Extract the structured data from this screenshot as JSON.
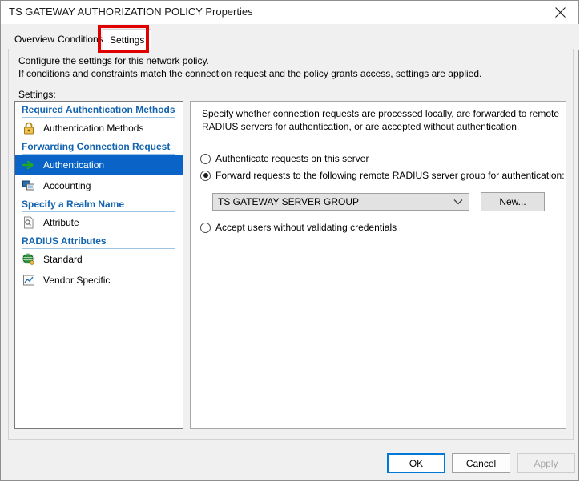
{
  "window": {
    "title": "TS GATEWAY AUTHORIZATION POLICY Properties",
    "close_icon": "close-icon"
  },
  "tabs": [
    {
      "label": "Overview",
      "selected": false
    },
    {
      "label": "Conditions",
      "selected": false
    },
    {
      "label": "Settings",
      "selected": true
    }
  ],
  "page": {
    "description_line1": "Configure the settings for this network policy.",
    "description_line2": "If conditions and constraints match the connection request and the policy grants access, settings are applied.",
    "settings_label": "Settings:"
  },
  "nav": {
    "groups": [
      {
        "header": "Required Authentication Methods",
        "items": [
          {
            "label": "Authentication Methods",
            "icon": "padlock-icon",
            "selected": false
          }
        ]
      },
      {
        "header": "Forwarding Connection Request",
        "items": [
          {
            "label": "Authentication",
            "icon": "green-arrow-icon",
            "selected": true
          },
          {
            "label": "Accounting",
            "icon": "monitor-icon",
            "selected": false
          }
        ]
      },
      {
        "header": "Specify a Realm Name",
        "items": [
          {
            "label": "Attribute",
            "icon": "document-search-icon",
            "selected": false
          }
        ]
      },
      {
        "header": "RADIUS Attributes",
        "items": [
          {
            "label": "Standard",
            "icon": "globe-key-icon",
            "selected": false
          },
          {
            "label": "Vendor Specific",
            "icon": "chart-icon",
            "selected": false
          }
        ]
      }
    ]
  },
  "detail": {
    "intro_line1": "Specify whether connection requests are processed locally, are forwarded to remote",
    "intro_line2": "RADIUS servers for authentication, or are accepted without authentication.",
    "options": [
      {
        "label": "Authenticate requests on this server",
        "checked": false
      },
      {
        "label": "Forward requests to the following remote RADIUS server group for authentication:",
        "checked": true
      },
      {
        "label": "Accept users without validating credentials",
        "checked": false
      }
    ],
    "server_group": {
      "value": "TS GATEWAY SERVER GROUP",
      "arrow_icon": "chevron-down-icon"
    },
    "new_button": "New..."
  },
  "footer": {
    "ok": "OK",
    "cancel": "Cancel",
    "apply": "Apply"
  },
  "annotation": {
    "color": "#e00000",
    "target": "Settings"
  }
}
